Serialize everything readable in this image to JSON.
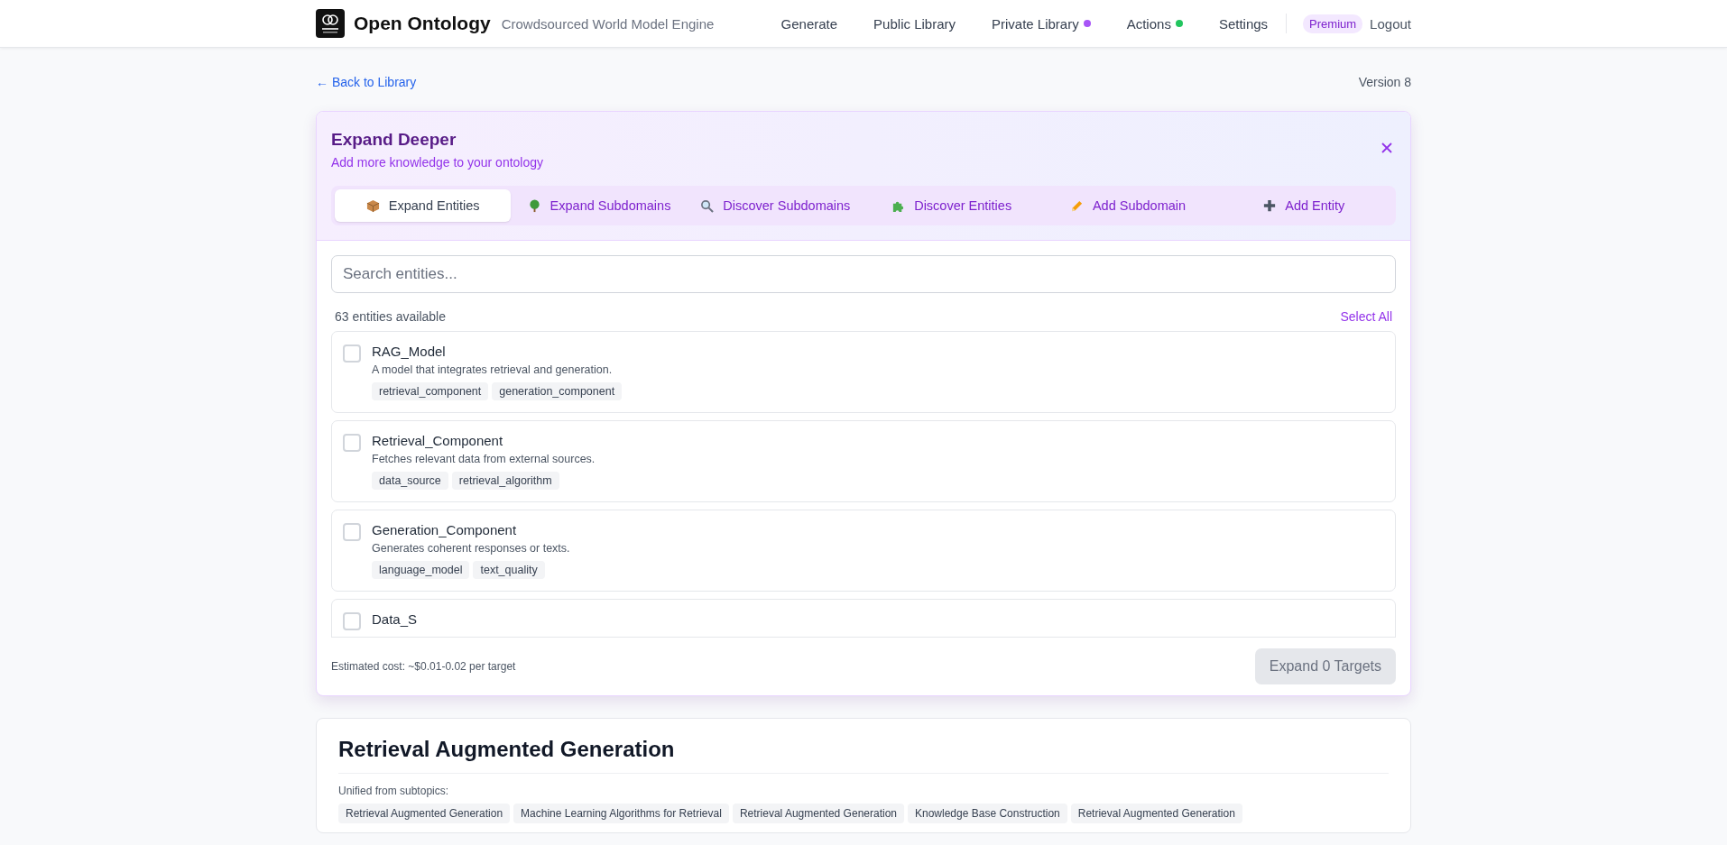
{
  "header": {
    "brand": "Open Ontology",
    "tagline": "Crowdsourced World Model Engine",
    "nav": [
      {
        "label": "Generate"
      },
      {
        "label": "Public Library"
      },
      {
        "label": "Private Library",
        "color": "#a855f7"
      },
      {
        "label": "Actions",
        "color": "#22c55e"
      },
      {
        "label": "Settings"
      }
    ],
    "badge": "Premium",
    "logout": "Logout"
  },
  "back_link": "← Back to Library",
  "version": "Version 8",
  "panel": {
    "title": "Expand Deeper",
    "subtitle": "Add more knowledge to your ontology",
    "tabs": [
      {
        "label": "Expand Entities",
        "selected": true
      },
      {
        "label": "Expand Subdomains",
        "selected": false
      },
      {
        "label": "Discover Subdomains",
        "selected": false
      },
      {
        "label": "Discover Entities",
        "selected": false
      },
      {
        "label": "Add Subdomain",
        "selected": false
      },
      {
        "label": "Add Entity",
        "selected": false
      }
    ],
    "search": {
      "placeholder": "Search entities..."
    },
    "count": "63 entities available",
    "select_all": "Select All",
    "entities": [
      {
        "name": "RAG_Model",
        "description": "A model that integrates retrieval and generation.",
        "tags": [
          "retrieval_component",
          "generation_component"
        ],
        "checked": false
      },
      {
        "name": "Retrieval_Component",
        "description": "Fetches relevant data from external sources.",
        "tags": [
          "data_source",
          "retrieval_algorithm"
        ],
        "checked": false
      },
      {
        "name": "Generation_Component",
        "description": "Generates coherent responses or texts.",
        "tags": [
          "language_model",
          "text_quality"
        ],
        "checked": false
      },
      {
        "name": "Data_S",
        "checked": false
      }
    ],
    "cost": "Estimated cost: ~$0.01-0.02 per target",
    "action": {
      "label": "Expand 0 Targets",
      "disabled": true
    }
  },
  "topic": {
    "title": "Retrieval Augmented Generation",
    "unified_label": "Unified from subtopics:",
    "subtopics": [
      "Retrieval Augmented Generation",
      "Machine Learning Algorithms for Retrieval",
      "Retrieval Augmented Generation",
      "Knowledge Base Construction",
      "Retrieval Augmented Generation"
    ]
  }
}
